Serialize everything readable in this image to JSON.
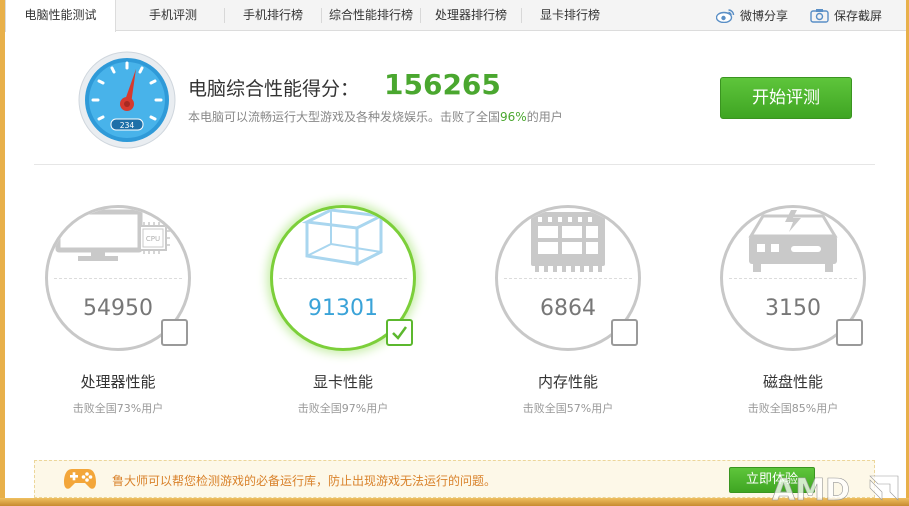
{
  "tabs": [
    {
      "label": "电脑性能测试",
      "active": true
    },
    {
      "label": "手机评测"
    },
    {
      "label": "手机排行榜"
    },
    {
      "label": "综合性能排行榜"
    },
    {
      "label": "处理器排行榜"
    },
    {
      "label": "显卡排行榜"
    }
  ],
  "share": {
    "weibo_label": "微博分享",
    "screenshot_label": "保存截屏"
  },
  "gauge": {
    "readout": "234"
  },
  "summary": {
    "title": "电脑综合性能得分：",
    "score": "156265",
    "desc_prefix": "本电脑可以流畅运行大型游戏及各种发烧娱乐。击败了全国",
    "desc_pct": "96%",
    "desc_suffix": "的用户",
    "start_button": "开始评测"
  },
  "metrics": [
    {
      "value": "54950",
      "label": "处理器性能",
      "sub": "击败全国73%用户",
      "checked": false,
      "icon": "monitor-cpu-icon",
      "icon_text": "CPU"
    },
    {
      "value": "91301",
      "label": "显卡性能",
      "sub": "击败全国97%用户",
      "checked": true,
      "icon": "cube-icon"
    },
    {
      "value": "6864",
      "label": "内存性能",
      "sub": "击败全国57%用户",
      "checked": false,
      "icon": "memory-chip-icon"
    },
    {
      "value": "3150",
      "label": "磁盘性能",
      "sub": "击败全国85%用户",
      "checked": false,
      "icon": "hard-disk-icon"
    }
  ],
  "notice": {
    "text": "鲁大师可以帮您检测游戏的必备运行库，防止出现游戏无法运行的问题。",
    "button": "立即体验",
    "icon": "gamepad-icon"
  },
  "watermark": "AMD",
  "colors": {
    "accent_green": "#4aa72f",
    "accent_blue": "#3aa3d8",
    "notice_orange": "#d9822b",
    "frame": "#e8b04a"
  }
}
